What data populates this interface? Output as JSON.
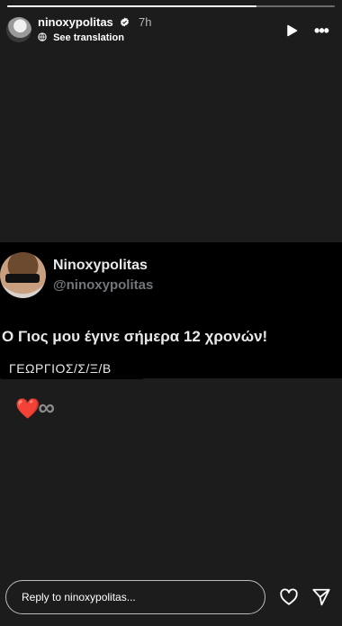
{
  "story": {
    "progress": 0.76,
    "username": "ninoxypolitas",
    "age": "7h",
    "translate": "See translation"
  },
  "card": {
    "display_name": "Ninoxypolitas",
    "handle": "@ninoxypolitas",
    "text": "Ο Γιος μου έγινε σήμερα 12 χρονών!",
    "label": "ΓΕΩΡΓΙΟΣ/Σ/Ξ/Β"
  },
  "emoji": {
    "heart": "❤️",
    "infinity": "∞"
  },
  "footer": {
    "reply_placeholder": "Reply to ninoxypolitas..."
  },
  "icons": {
    "verified": "verified-badge-icon",
    "play": "play-icon",
    "more": "more-options-icon",
    "like": "heart-icon",
    "send": "send-icon"
  }
}
